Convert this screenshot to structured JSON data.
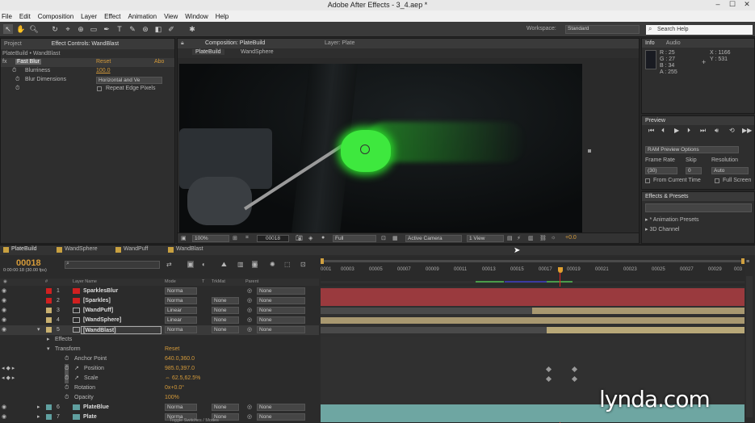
{
  "window": {
    "title": "Adobe After Effects - 3_4.aep *",
    "min": "–",
    "max": "☐",
    "close": "✕"
  },
  "menu": [
    "File",
    "Edit",
    "Composition",
    "Layer",
    "Effect",
    "Animation",
    "View",
    "Window",
    "Help"
  ],
  "toolbar": {
    "workspace_label": "Workspace:",
    "workspace_value": "Standard",
    "search_placeholder": "Search Help"
  },
  "left_panel": {
    "tab_project": "Project",
    "tab_effect": "Effect Controls: WandBlast",
    "breadcrumb": "PlateBuild • WandBlast",
    "effect_name": "Fast Blur",
    "reset": "Reset",
    "about": "Abo",
    "blurriness_label": "Blurriness",
    "blurriness_value": "100.0",
    "dimensions_label": "Blur Dimensions",
    "dimensions_value": "Horizontal and Ve",
    "repeat_label": "Repeat Edge Pixels"
  },
  "comp_panel": {
    "tab_comp": "Composition: PlateBuild",
    "tab_layer": "Layer: Plate",
    "sub_tab1": "PlateBuild",
    "sub_tab2": "WandSphere",
    "zoom": "100%",
    "timecode": "00018",
    "resolution": "Full",
    "camera": "Active Camera",
    "views": "1 View",
    "exposure": "+0.0"
  },
  "info": {
    "tab_info": "Info",
    "tab_audio": "Audio",
    "r": "R : 25",
    "g": "G : 27",
    "b": "B : 34",
    "a": "A : 255",
    "x": "X : 1166",
    "y": "Y : 531"
  },
  "preview": {
    "tab": "Preview",
    "ram_options": "RAM Preview Options",
    "frame_rate_label": "Frame Rate",
    "skip_label": "Skip",
    "resolution_label": "Resolution",
    "frame_rate_value": "(30)",
    "skip_value": "0",
    "resolution_value": "Auto",
    "from_current": "From Current Time",
    "full_screen": "Full Screen"
  },
  "effects_presets": {
    "tab": "Effects & Presets",
    "item1": "▸ * Animation Presets",
    "item2": "▸ 3D Channel"
  },
  "timeline": {
    "tabs": [
      "PlateBuild",
      "WandSphere",
      "WandPuff",
      "WandBlast"
    ],
    "timecode": "00018",
    "timecode_sub": "0:00:00:18 (30.00 fps)",
    "col_layer": "Layer Name",
    "col_mode": "Mode",
    "col_t": "T",
    "col_trkmat": "TrkMat",
    "col_parent": "Parent",
    "ruler": [
      "00003",
      "00005",
      "00007",
      "00009",
      "00011",
      "00013",
      "00015",
      "00017",
      "00019",
      "00021",
      "00023",
      "00025",
      "00027",
      "00029",
      "003"
    ],
    "ruler_start": "0001",
    "toggle_label": "Toggle Switches / Modes",
    "layers": [
      {
        "num": "1",
        "name": "SparklesBlur",
        "mode": "Norma",
        "trkmat": "",
        "parent": "None",
        "color": "#d02020"
      },
      {
        "num": "2",
        "name": "[Sparkles]",
        "mode": "Norma",
        "trkmat": "None",
        "parent": "None",
        "color": "#d02020"
      },
      {
        "num": "3",
        "name": "[WandPuff]",
        "mode": "Linear",
        "trkmat": "None",
        "parent": "None",
        "color": "#c8b070"
      },
      {
        "num": "4",
        "name": "[WandSphere]",
        "mode": "Linear",
        "trkmat": "None",
        "parent": "None",
        "color": "#c8b070"
      },
      {
        "num": "5",
        "name": "[WandBlast]",
        "mode": "Norma",
        "trkmat": "None",
        "parent": "None",
        "color": "#c8b070"
      },
      {
        "num": "6",
        "name": "PlateBlue",
        "mode": "Norma",
        "trkmat": "None",
        "parent": "None",
        "color": "#60a0a0"
      },
      {
        "num": "7",
        "name": "Plate",
        "mode": "Norma",
        "trkmat": "None",
        "parent": "None",
        "color": "#60a0a0"
      }
    ],
    "props": {
      "effects": "Effects",
      "transform": "Transform",
      "reset": "Reset",
      "anchor": "Anchor Point",
      "anchor_val": "640.0,360.0",
      "position": "Position",
      "position_val": "985.0,397.0",
      "scale": "Scale",
      "scale_val": "⇔ 62.5,62.5%",
      "rotation": "Rotation",
      "rotation_val": "0x+0.0°",
      "opacity": "Opacity",
      "opacity_val": "100%"
    }
  },
  "watermark": "lynda.com"
}
